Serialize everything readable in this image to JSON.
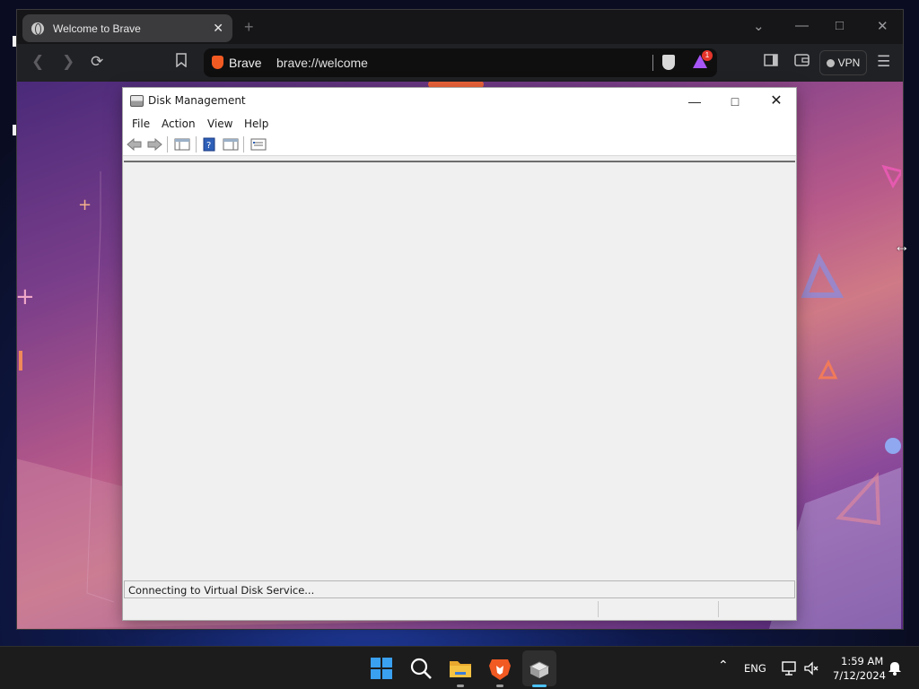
{
  "browser": {
    "tab_title": "Welcome to Brave",
    "tab_close": "✕",
    "new_tab": "+",
    "omnibox_brand": "Brave",
    "url": "brave://welcome",
    "rewards_badge": "1",
    "vpn_label": "VPN"
  },
  "disk_management": {
    "title": "Disk Management",
    "menu": [
      "File",
      "Action",
      "View",
      "Help"
    ],
    "status_text": "Connecting to Virtual Disk Service..."
  },
  "taskbar": {
    "language": "ENG",
    "time": "1:59 AM",
    "date": "7/12/2024"
  },
  "colors": {
    "brave_orange": "#f15a22",
    "windows_blue": "#3aa0f0",
    "folder_yellow": "#f5c242"
  }
}
